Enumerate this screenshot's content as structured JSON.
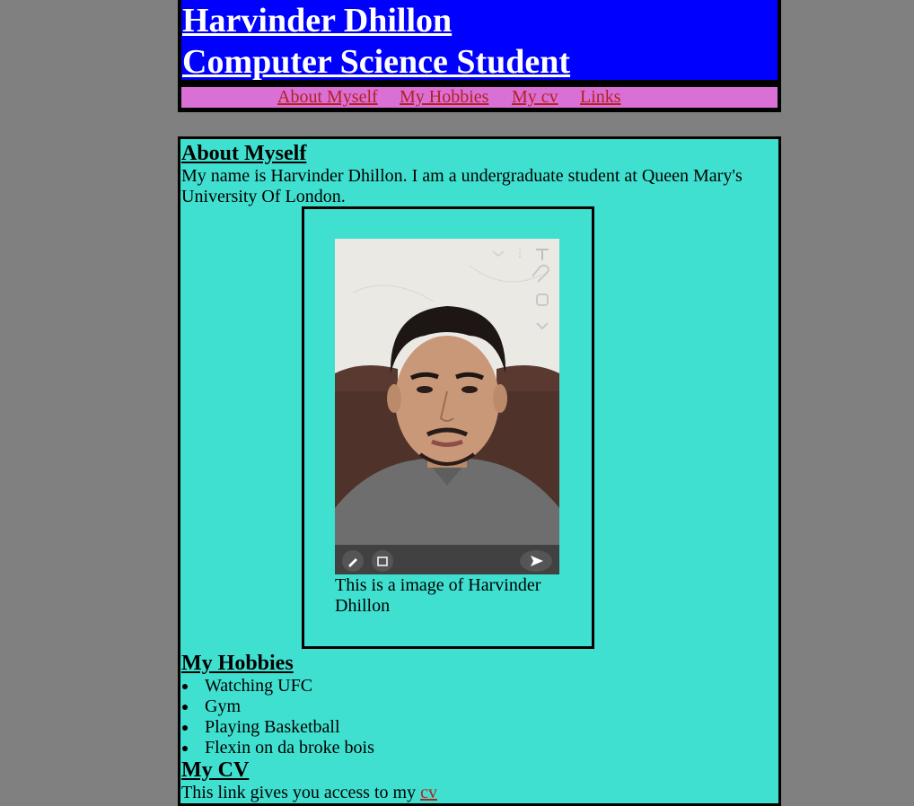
{
  "header": {
    "name_line": "Harvinder Dhillon",
    "role_line": "Computer Science Student"
  },
  "nav": {
    "items": [
      {
        "label": "About Myself"
      },
      {
        "label": "My Hobbies"
      },
      {
        "label": "My cv"
      },
      {
        "label": "Links"
      }
    ]
  },
  "about": {
    "heading": "About Myself",
    "text": "My name is Harvinder Dhillon. I am a undergraduate student at Queen Mary's University Of London.",
    "caption": "This is a image of Harvinder Dhillon"
  },
  "hobbies": {
    "heading": "My Hobbies",
    "items": [
      "Watching UFC",
      "Gym",
      "Playing Basketball",
      "Flexin on da broke bois"
    ]
  },
  "cv": {
    "heading": "My CV",
    "text": "This link gives you access to my ",
    "link_label": "cv"
  },
  "colors": {
    "page_bg": "#808080",
    "title_bg": "#0000ff",
    "nav_bg": "#da70d6",
    "link": "#b22222",
    "content_bg": "#40e0d0"
  },
  "icons": {
    "photo_overlay": [
      "text-tool-icon",
      "paperclip-icon",
      "sticker-icon",
      "chevron-down-icon",
      "pencil-icon",
      "crop-icon",
      "send-arrow-icon"
    ]
  }
}
